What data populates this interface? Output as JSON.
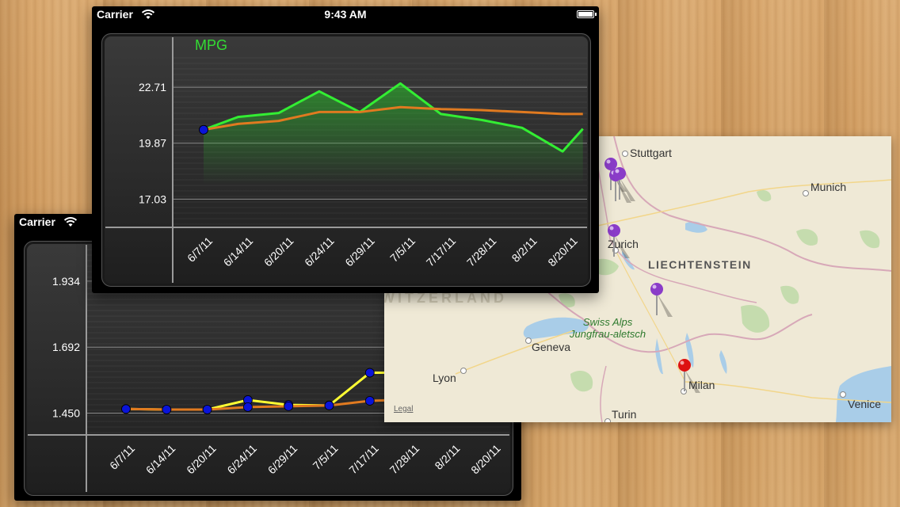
{
  "screen_back": {
    "status": {
      "carrier": "Carrier"
    },
    "chart_data": {
      "type": "line",
      "categories": [
        "6/7/11",
        "6/14/11",
        "6/20/11",
        "6/24/11",
        "6/29/11",
        "7/5/11",
        "7/17/11",
        "7/28/11",
        "8/2/11",
        "8/20/11"
      ],
      "ytick_labels": [
        "1.934",
        "1.692",
        "1.450"
      ],
      "yticks": [
        1.934,
        1.692,
        1.45
      ],
      "ylim": [
        1.37,
        2.05
      ],
      "series": [
        {
          "values": [
            1.465,
            1.463,
            1.463,
            1.498,
            1.48,
            1.478,
            1.598,
            1.598,
            null,
            null
          ],
          "color": "#ffff33"
        },
        {
          "values": [
            1.465,
            1.463,
            1.463,
            1.472,
            1.475,
            1.478,
            1.495,
            1.5,
            null,
            null
          ],
          "color": "#e07a20"
        }
      ],
      "point_color": "#0a14d8",
      "grid": true
    }
  },
  "screen_front": {
    "status": {
      "carrier": "Carrier",
      "time": "9:43 AM"
    },
    "chart_data": {
      "type": "line",
      "title": "MPG",
      "title_color": "#33dd33",
      "categories": [
        "6/7/11",
        "6/14/11",
        "6/20/11",
        "6/24/11",
        "6/29/11",
        "7/5/11",
        "7/17/11",
        "7/28/11",
        "8/2/11",
        "8/20/11"
      ],
      "ytick_labels": [
        "22.71",
        "19.87",
        "17.03"
      ],
      "yticks": [
        22.71,
        19.87,
        17.03
      ],
      "ylim": [
        15.6,
        24.2
      ],
      "series": [
        {
          "values": [
            20.55,
            21.2,
            21.4,
            22.5,
            21.45,
            22.9,
            21.35,
            21.05,
            20.65,
            19.45,
            20.6
          ],
          "color": "#33ee33",
          "x": [
            0,
            0.85,
            1.85,
            2.85,
            3.85,
            4.85,
            5.85,
            6.85,
            7.85,
            8.85,
            9.35
          ]
        },
        {
          "values": [
            20.55,
            20.85,
            21.0,
            21.45,
            21.45,
            21.7,
            21.6,
            21.55,
            21.45,
            21.35,
            21.35
          ],
          "color": "#e07a20",
          "x": [
            0,
            0.85,
            1.85,
            2.85,
            3.85,
            4.85,
            5.85,
            6.85,
            7.85,
            8.85,
            9.35
          ]
        }
      ],
      "point_color": "#0a14d8",
      "grid": true
    }
  },
  "map": {
    "cities": [
      {
        "name": "Stuttgart"
      },
      {
        "name": "Munich"
      },
      {
        "name": "Zurich"
      },
      {
        "name": "Geneva"
      },
      {
        "name": "Lyon"
      },
      {
        "name": "Milan"
      },
      {
        "name": "Turin"
      },
      {
        "name": "Venice"
      }
    ],
    "country_label": "LIECHTENSTEIN",
    "faint_label": "SWITZERLAND",
    "park_line1": "Swiss Alps",
    "park_line2": "Jungfrau-aletsch",
    "legal": "Legal",
    "pin_colors": {
      "normal": "#8a3cc8",
      "selected": "#dd1111"
    }
  }
}
